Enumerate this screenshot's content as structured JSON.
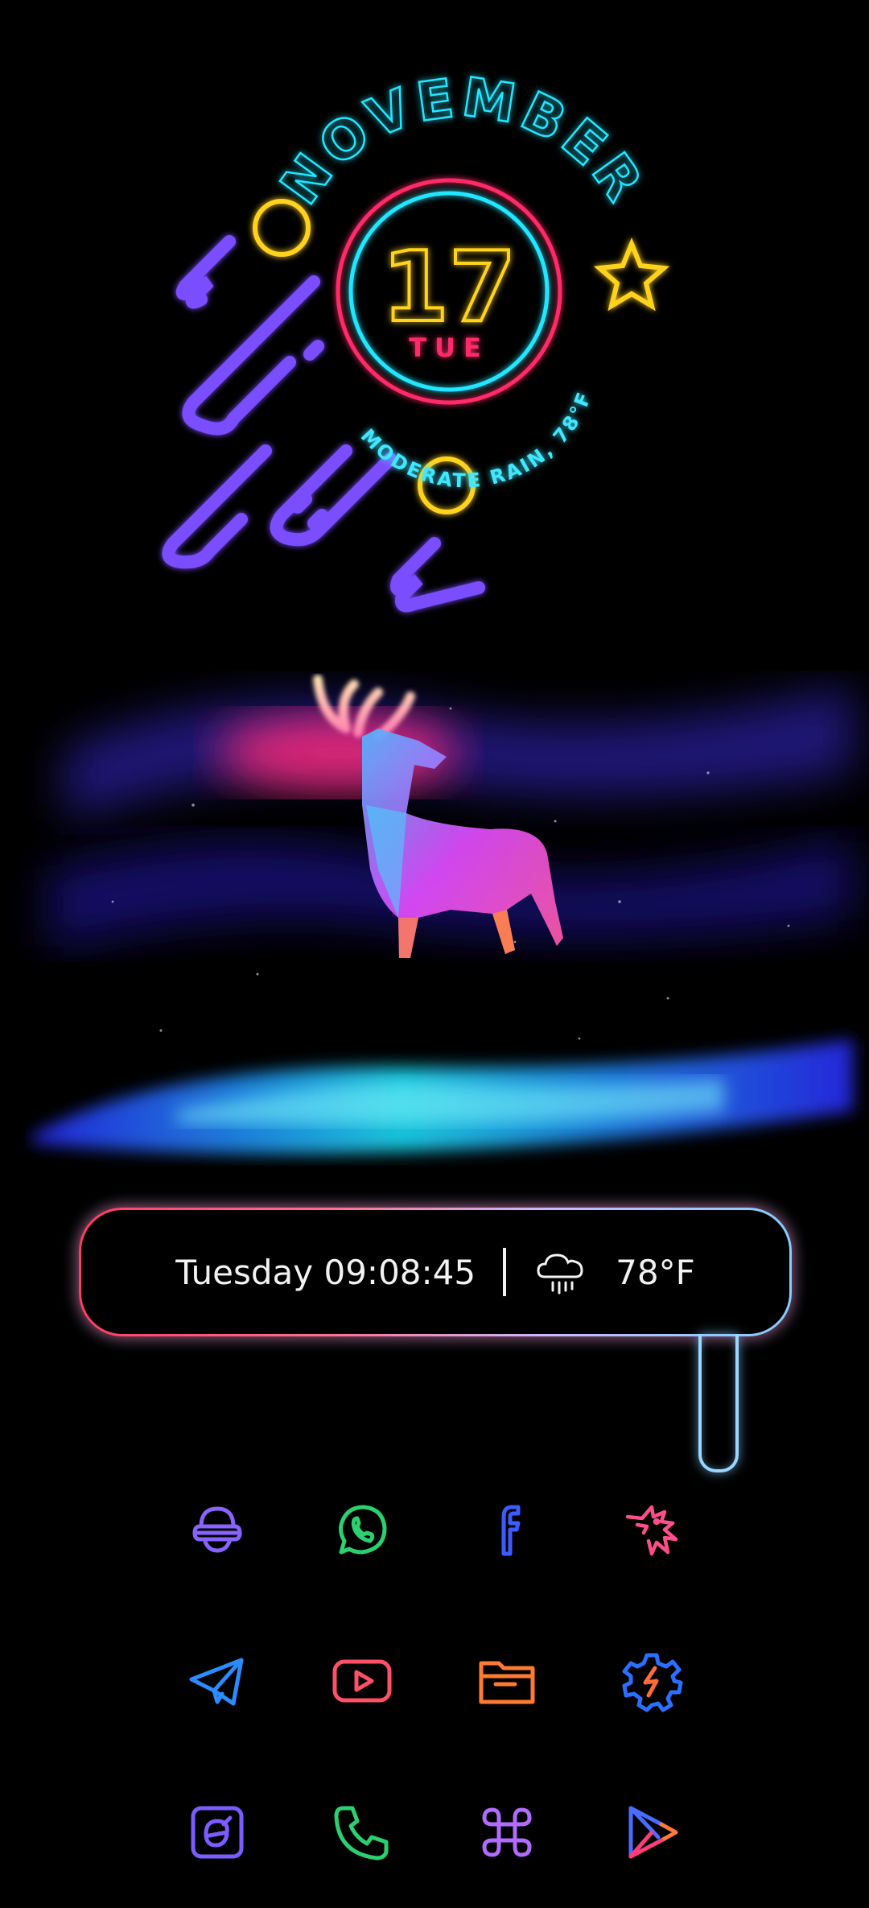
{
  "widget": {
    "month": "NOVEMBER",
    "day": "17",
    "weekday": "TUE",
    "weather_line": "MODERATE RAIN, 78°F"
  },
  "status_bar": {
    "datetime": "Tuesday 09:08:45",
    "weather_icon": "rain-cloud-icon",
    "temperature": "78°F"
  },
  "apps": [
    {
      "icon": "boost-icon",
      "color": "#8a63ff"
    },
    {
      "icon": "whatsapp-icon",
      "color": "#2bd06f"
    },
    {
      "icon": "facebook-icon",
      "color": "#3c5cff"
    },
    {
      "icon": "dragon-icon",
      "color": "#ff4f8a"
    },
    {
      "icon": "telegram-icon",
      "color": "#2a8cff"
    },
    {
      "icon": "youtube-icon",
      "color": "#ff4f6a"
    },
    {
      "icon": "folder-icon",
      "color": "#ff7a32"
    },
    {
      "icon": "settings-icon",
      "color": "#2a6fff"
    },
    {
      "icon": "browser-icon",
      "color": "#7a5cff"
    },
    {
      "icon": "phone-icon",
      "color": "#2bd06f"
    },
    {
      "icon": "command-icon",
      "color": "#b16cff"
    },
    {
      "icon": "play-store-icon",
      "color": "#6b5cff"
    }
  ]
}
